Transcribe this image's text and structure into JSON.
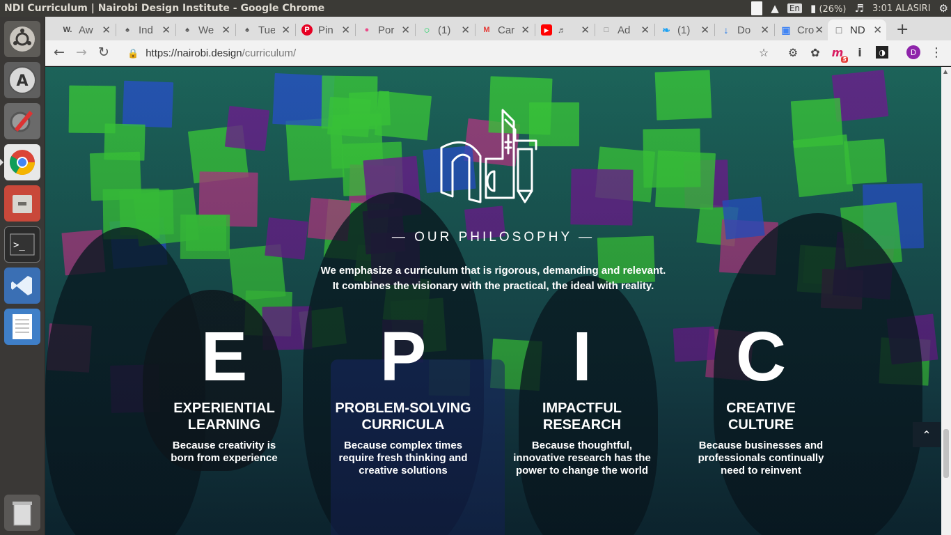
{
  "window": {
    "title": "NDI Curriculum | Nairobi Design Institute - Google Chrome"
  },
  "system_tray": {
    "keyboard": "En",
    "battery": "(26%)",
    "clock": "3:01 ALASIRI"
  },
  "launcher": {
    "items": [
      {
        "name": "dash-home-icon"
      },
      {
        "name": "software-updater-icon"
      },
      {
        "name": "system-settings-icon"
      },
      {
        "name": "chrome-icon"
      },
      {
        "name": "files-icon"
      },
      {
        "name": "terminal-icon"
      },
      {
        "name": "vscode-icon"
      },
      {
        "name": "text-editor-icon"
      },
      {
        "name": "trash-icon"
      }
    ]
  },
  "tabs": [
    {
      "label": "Aw",
      "favicon": "W."
    },
    {
      "label": "Ind",
      "favicon": "♠"
    },
    {
      "label": "We",
      "favicon": "♠"
    },
    {
      "label": "Tue",
      "favicon": "♠"
    },
    {
      "label": "Pin",
      "favicon": "P"
    },
    {
      "label": "Por",
      "favicon": "●"
    },
    {
      "label": "(1)",
      "favicon": "○"
    },
    {
      "label": "Car",
      "favicon": "M"
    },
    {
      "label": "",
      "favicon": "▶"
    },
    {
      "label": "Ad",
      "favicon": "□"
    },
    {
      "label": "(1)",
      "favicon": "❧"
    },
    {
      "label": "Do",
      "favicon": "↓"
    },
    {
      "label": "Cro",
      "favicon": "▣"
    },
    {
      "label": "ND",
      "favicon": "□",
      "active": true
    }
  ],
  "address_bar": {
    "host": "https://nairobi.design",
    "path": "/curriculum/"
  },
  "extension_badge": "5",
  "profile_initial": "D",
  "page": {
    "section_title": "— OUR PHILOSOPHY —",
    "tagline_1": "We emphasize a curriculum that is rigorous, demanding and relevant.",
    "tagline_2": "It combines the visionary with the practical, the ideal with reality.",
    "pillars": [
      {
        "letter": "E",
        "title_1": "EXPERIENTIAL",
        "title_2": "LEARNING",
        "desc_1": "Because creativity is",
        "desc_2": "born from experience",
        "desc_3": ""
      },
      {
        "letter": "P",
        "title_1": "PROBLEM-SOLVING",
        "title_2": "CURRICULA",
        "desc_1": "Because complex times",
        "desc_2": "require fresh thinking and",
        "desc_3": "creative solutions"
      },
      {
        "letter": "I",
        "title_1": "IMPACTFUL",
        "title_2": "RESEARCH",
        "desc_1": "Because thoughtful,",
        "desc_2": "innovative research has the",
        "desc_3": "power to change the world"
      },
      {
        "letter": "C",
        "title_1": "CREATIVE",
        "title_2": "CULTURE",
        "desc_1": "Because businesses and",
        "desc_2": "professionals continually",
        "desc_3": "need to reinvent"
      }
    ]
  },
  "colors": {
    "note_green": "#3fd83a",
    "note_purple": "#7a1a9a",
    "note_blue": "#2a55d8",
    "note_pink": "#c23a8a"
  }
}
